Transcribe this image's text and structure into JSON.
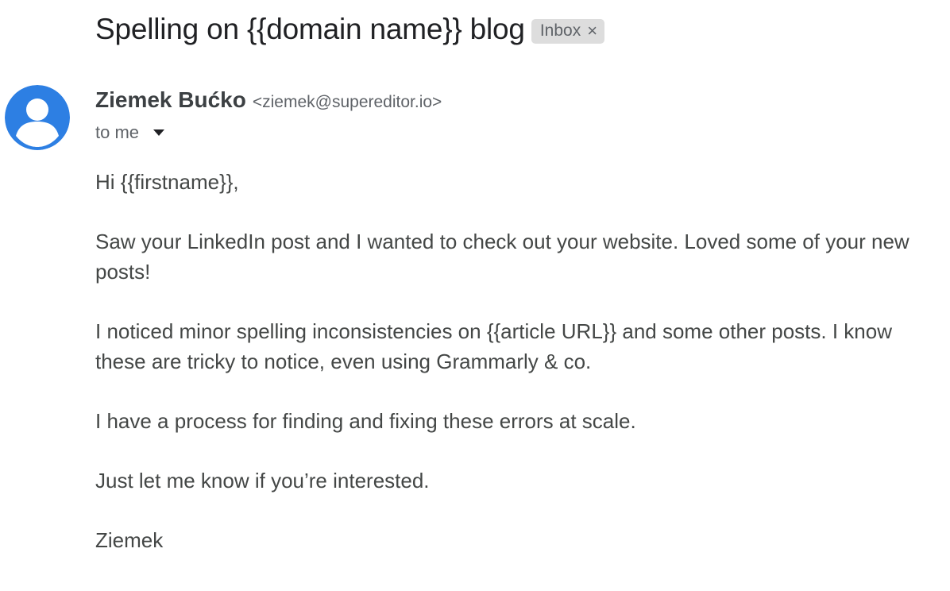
{
  "subject": "Spelling on {{domain name}} blog",
  "label": {
    "text": "Inbox",
    "close_glyph": "×"
  },
  "avatar": {
    "icon": "person-icon",
    "color": "#2d7fe3"
  },
  "sender": {
    "name": "Ziemek Bućko",
    "email": "<ziemek@supereditor.io>"
  },
  "recipient": {
    "text": "to me",
    "dropdown_icon": "caret-down-icon"
  },
  "message": {
    "paragraphs": [
      "Hi {{firstname}},",
      "Saw your LinkedIn post and I wanted to check out your website. Loved some of your new posts!",
      "I noticed minor spelling inconsistencies on {{article URL}} and some other posts. I know these are tricky to notice, even using Grammarly & co.",
      "I have a process for finding and fixing these errors at scale.",
      "Just let me know if you’re interested.",
      "Ziemek"
    ]
  }
}
